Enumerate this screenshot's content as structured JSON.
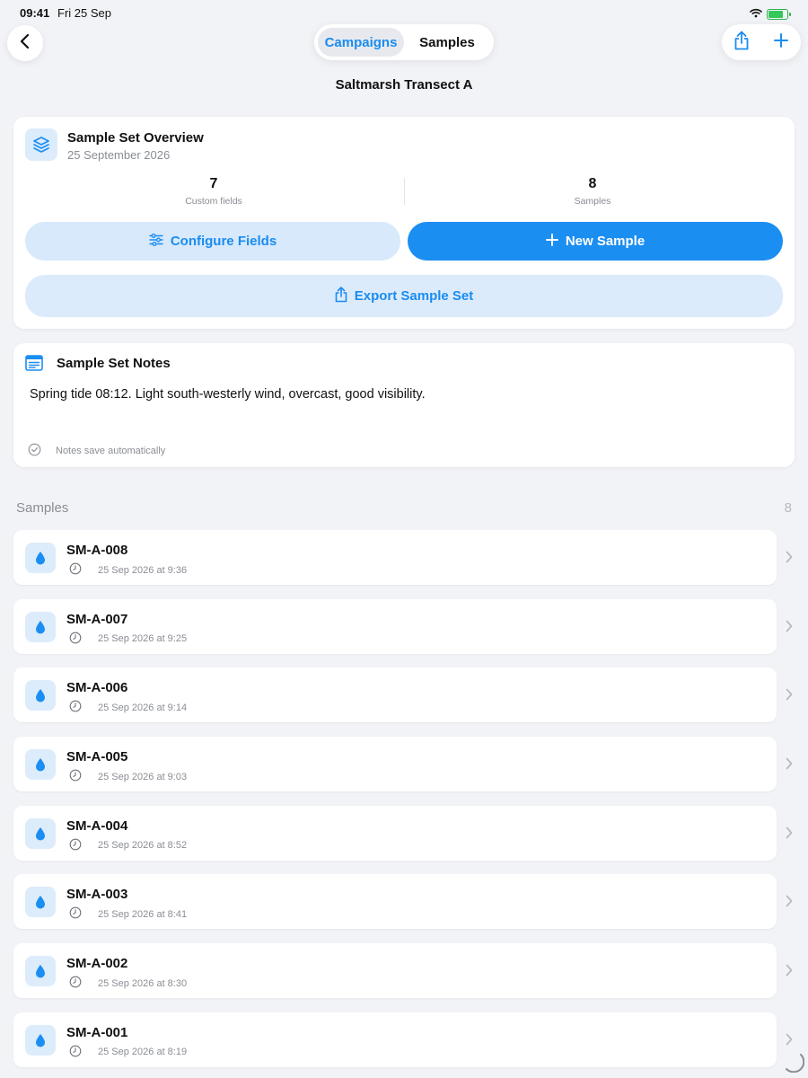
{
  "status_bar": {
    "time": "09:41",
    "date": "Fri 25 Sep",
    "battery_fill": 0.85,
    "battery_color": "#34c759"
  },
  "nav": {
    "back_icon": "chevron-left-icon",
    "segments": [
      {
        "label": "Campaigns",
        "active": true
      },
      {
        "label": "Samples",
        "active": false
      }
    ],
    "actions": [
      "share-icon",
      "plus-icon"
    ],
    "title": "Saltmarsh Transect A"
  },
  "overview": {
    "icon": "layers-icon",
    "title": "Sample Set Overview",
    "date": "25 September 2026",
    "stats": [
      {
        "value": "7",
        "label": "Custom fields"
      },
      {
        "value": "8",
        "label": "Samples"
      }
    ],
    "configure_label": "Configure Fields",
    "new_sample_label": "New Sample",
    "export_label": "Export Sample Set"
  },
  "notes": {
    "icon": "notes-icon",
    "title": "Sample Set Notes",
    "text": "Spring tide 08:12. Light south-westerly wind, overcast, good visibility.",
    "footer": "Notes save automatically"
  },
  "samples_section": {
    "header": "Samples",
    "count": "8",
    "items": [
      {
        "id": "SM-A-008",
        "time": "25 Sep 2026 at 9:36"
      },
      {
        "id": "SM-A-007",
        "time": "25 Sep 2026 at 9:25"
      },
      {
        "id": "SM-A-006",
        "time": "25 Sep 2026 at 9:14"
      },
      {
        "id": "SM-A-005",
        "time": "25 Sep 2026 at 9:03"
      },
      {
        "id": "SM-A-004",
        "time": "25 Sep 2026 at 8:52"
      },
      {
        "id": "SM-A-003",
        "time": "25 Sep 2026 at 8:41"
      },
      {
        "id": "SM-A-002",
        "time": "25 Sep 2026 at 8:30"
      },
      {
        "id": "SM-A-001",
        "time": "25 Sep 2026 at 8:19"
      }
    ]
  },
  "colors": {
    "accent": "#1b8ef2",
    "accent_light": "#d7e9fb",
    "background": "#f2f3f7"
  }
}
